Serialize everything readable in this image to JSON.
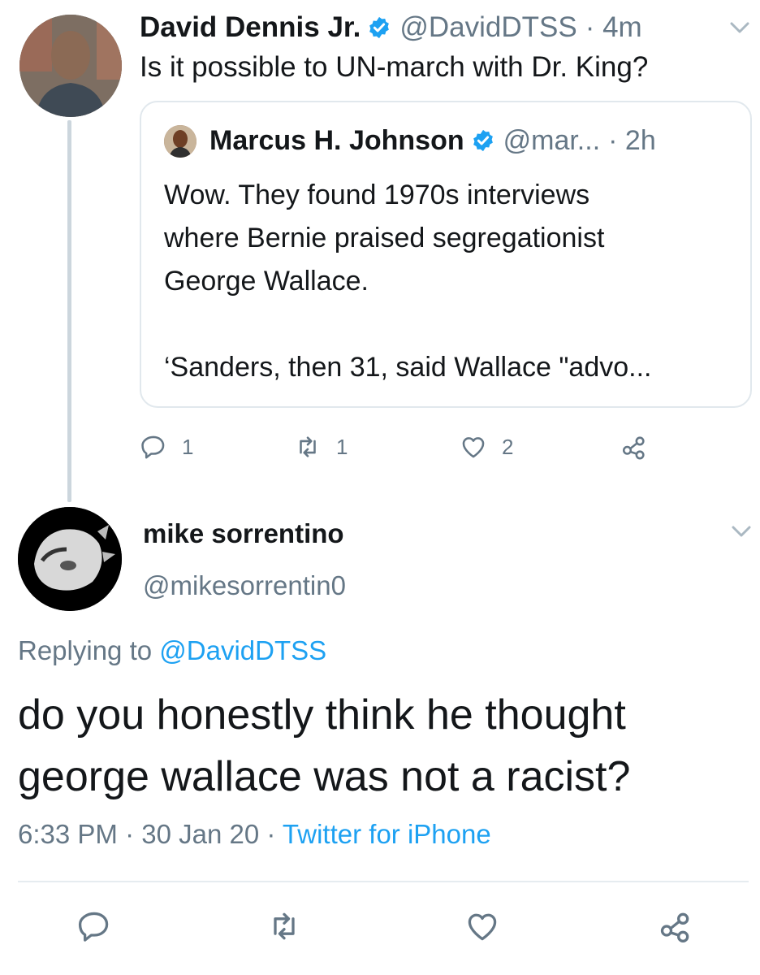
{
  "parent_tweet": {
    "author_name": "David Dennis Jr.",
    "handle": "@DavidDTSS",
    "time": "· 4m",
    "text": "Is it possible to UN-march with Dr. King?",
    "quoted": {
      "author_name": "Marcus H. Johnson",
      "handle": "@mar...",
      "time": "· 2h",
      "lines": [
        "Wow. They found 1970s interviews",
        "where Bernie praised segregationist",
        "George Wallace.",
        "",
        "‘Sanders, then 31, said Wallace \"advo..."
      ]
    },
    "actions": {
      "reply_count": "1",
      "retweet_count": "1",
      "like_count": "2"
    }
  },
  "reply_tweet": {
    "author_name": "mike sorrentino",
    "handle": "@mikesorrentin0",
    "replying_prefix": "Replying to ",
    "replying_to": "@DavidDTSS",
    "text_lines": [
      "do you honestly think he thought",
      "george wallace was not a racist?"
    ],
    "timestamp": "6:33 PM · 30 Jan 20 · ",
    "source": "Twitter for iPhone"
  },
  "colors": {
    "accent": "#1da1f2",
    "secondary_text": "#657786",
    "border": "#e1e8ed"
  },
  "icons": [
    "chevron-down-icon",
    "verified-icon",
    "reply-icon",
    "retweet-icon",
    "like-icon",
    "share-icon"
  ]
}
